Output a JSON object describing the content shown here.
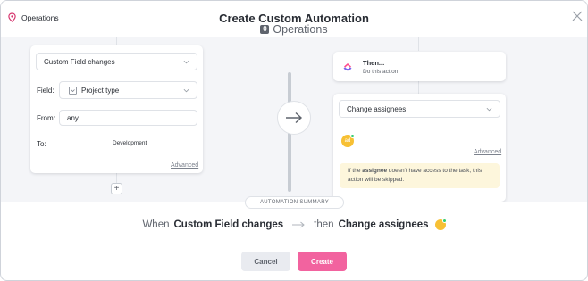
{
  "header": {
    "location": "Operations",
    "title": "Create Custom Automation",
    "operations_count": "0",
    "operations_label": "Operations"
  },
  "trigger": {
    "select_value": "Custom Field changes",
    "field_label": "Field:",
    "field_value": "Project type",
    "from_label": "From:",
    "from_value": "any",
    "to_label": "To:",
    "to_value": "Development",
    "advanced": "Advanced"
  },
  "action_header": {
    "title": "Then...",
    "subtitle": "Do this action"
  },
  "action": {
    "select_value": "Change assignees",
    "avatar_initials": "ad",
    "advanced": "Advanced",
    "warning_pre": "If the ",
    "warning_bold": "assignee",
    "warning_post": " doesn't have access to the task, this action will be skipped."
  },
  "summary": {
    "tag": "AUTOMATION SUMMARY",
    "when": "When",
    "trigger": "Custom Field changes",
    "then": "then",
    "action": "Change assignees"
  },
  "buttons": {
    "cancel": "Cancel",
    "create": "Create"
  },
  "colors": {
    "accent_pink": "#f2639f",
    "location_pin": "#d6336c",
    "avatar_yellow": "#f7c034",
    "online_green": "#2ecd6f"
  }
}
